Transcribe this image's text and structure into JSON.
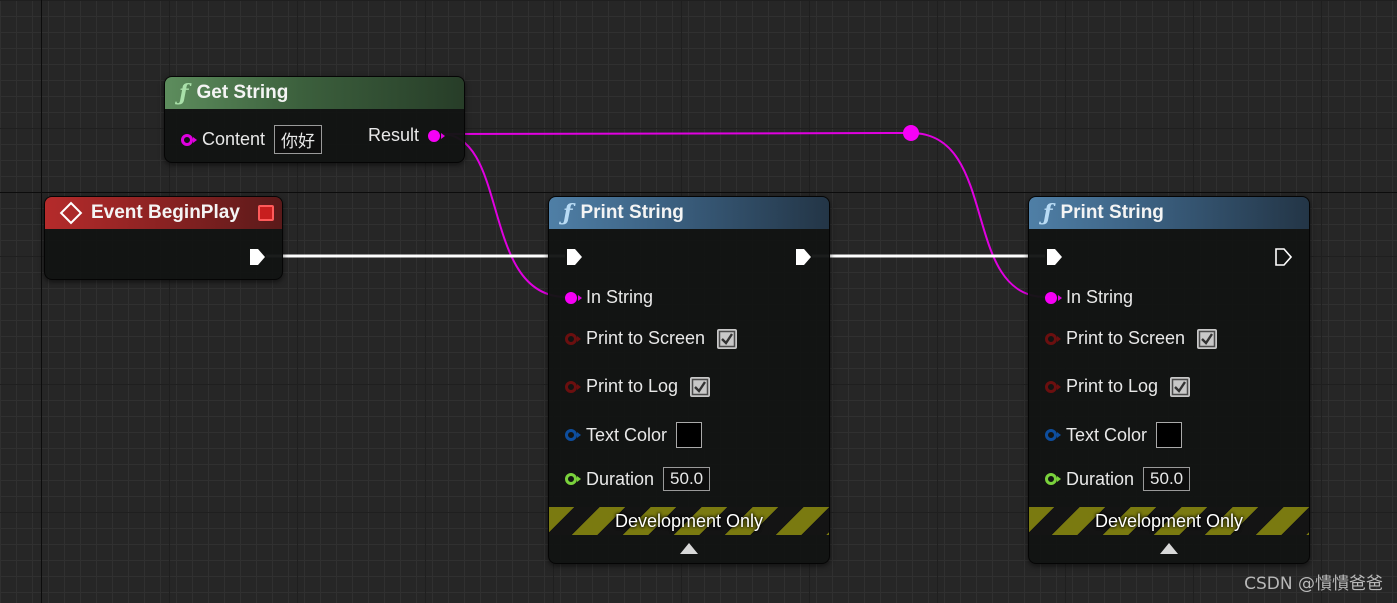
{
  "nodes": {
    "get_string": {
      "title": "Get String",
      "content_label": "Content",
      "content_value": "你好",
      "result_label": "Result"
    },
    "event_begin_play": {
      "title": "Event BeginPlay"
    },
    "print_string_1": {
      "title": "Print String",
      "in_string_label": "In String",
      "print_to_screen_label": "Print to Screen",
      "print_to_screen_checked": true,
      "print_to_log_label": "Print to Log",
      "print_to_log_checked": true,
      "text_color_label": "Text Color",
      "text_color_value": "#000000",
      "duration_label": "Duration",
      "duration_value": "50.0",
      "dev_only_label": "Development Only"
    },
    "print_string_2": {
      "title": "Print String",
      "in_string_label": "In String",
      "print_to_screen_label": "Print to Screen",
      "print_to_screen_checked": true,
      "print_to_log_label": "Print to Log",
      "print_to_log_checked": true,
      "text_color_label": "Text Color",
      "text_color_value": "#000000",
      "duration_label": "Duration",
      "duration_value": "50.0",
      "dev_only_label": "Development Only"
    }
  },
  "colors": {
    "string_wire": "#e000e0",
    "exec_wire": "#ffffff",
    "function_header_green": "#3c603d",
    "function_header_blue": "#3a5e7e",
    "event_header_red": "#8a2222"
  },
  "watermark": "CSDN @憒憒爸爸"
}
